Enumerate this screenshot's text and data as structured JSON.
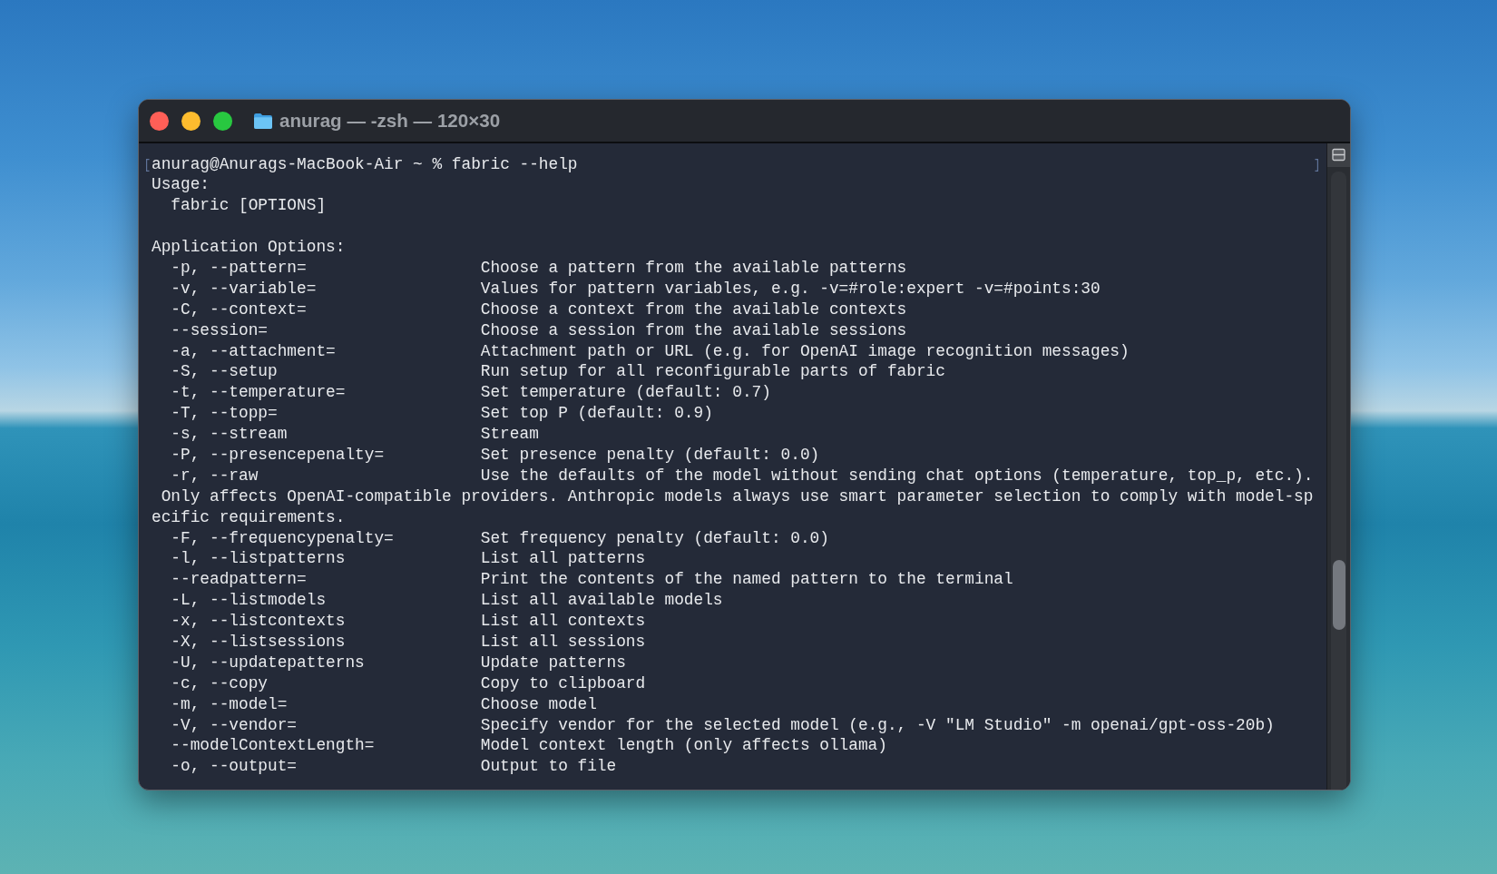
{
  "window": {
    "title": "anurag — -zsh — 120×30",
    "controls": [
      {
        "color": "#ff5f57"
      },
      {
        "color": "#febc2e"
      },
      {
        "color": "#28c840"
      }
    ]
  },
  "terminal": {
    "prompt": {
      "text": "anurag@Anurags-MacBook-Air ~ % fabric --help",
      "marked": true
    },
    "lines": [
      {
        "kind": "plain",
        "text": "Usage:"
      },
      {
        "kind": "indented",
        "text": "fabric [OPTIONS]"
      },
      {
        "kind": "blank"
      },
      {
        "kind": "plain",
        "text": "Application Options:"
      },
      {
        "kind": "option",
        "flag": "-p, --pattern=",
        "description": "Choose a pattern from the available patterns"
      },
      {
        "kind": "option",
        "flag": "-v, --variable=",
        "description": "Values for pattern variables, e.g. -v=#role:expert -v=#points:30"
      },
      {
        "kind": "option",
        "flag": "-C, --context=",
        "description": "Choose a context from the available contexts"
      },
      {
        "kind": "option",
        "flag": "--session=",
        "description": "Choose a session from the available sessions"
      },
      {
        "kind": "option",
        "flag": "-a, --attachment=",
        "description": "Attachment path or URL (e.g. for OpenAI image recognition messages)"
      },
      {
        "kind": "option",
        "flag": "-S, --setup",
        "description": "Run setup for all reconfigurable parts of fabric"
      },
      {
        "kind": "option",
        "flag": "-t, --temperature=",
        "description": "Set temperature (default: 0.7)"
      },
      {
        "kind": "option",
        "flag": "-T, --topp=",
        "description": "Set top P (default: 0.9)"
      },
      {
        "kind": "option",
        "flag": "-s, --stream",
        "description": "Stream"
      },
      {
        "kind": "option",
        "flag": "-P, --presencepenalty=",
        "description": "Set presence penalty (default: 0.0)"
      },
      {
        "kind": "option",
        "flag": "-r, --raw",
        "description": "Use the defaults of the model without sending chat options (temperature, top_p, etc.)."
      },
      {
        "kind": "wrapped",
        "text": "Only affects OpenAI-compatible providers. Anthropic models always use smart parameter selection to comply with model-sp"
      },
      {
        "kind": "plain",
        "text": "ecific requirements."
      },
      {
        "kind": "option",
        "flag": "-F, --frequencypenalty=",
        "description": "Set frequency penalty (default: 0.0)"
      },
      {
        "kind": "option",
        "flag": "-l, --listpatterns",
        "description": "List all patterns"
      },
      {
        "kind": "option",
        "flag": "--readpattern=",
        "description": "Print the contents of the named pattern to the terminal"
      },
      {
        "kind": "option",
        "flag": "-L, --listmodels",
        "description": "List all available models"
      },
      {
        "kind": "option",
        "flag": "-x, --listcontexts",
        "description": "List all contexts"
      },
      {
        "kind": "option",
        "flag": "-X, --listsessions",
        "description": "List all sessions"
      },
      {
        "kind": "option",
        "flag": "-U, --updatepatterns",
        "description": "Update patterns"
      },
      {
        "kind": "option",
        "flag": "-c, --copy",
        "description": "Copy to clipboard"
      },
      {
        "kind": "option",
        "flag": "-m, --model=",
        "description": "Choose model"
      },
      {
        "kind": "option",
        "flag": "-V, --vendor=",
        "description": "Specify vendor for the selected model (e.g., -V \"LM Studio\" -m openai/gpt-oss-20b)"
      },
      {
        "kind": "option",
        "flag": "--modelContextLength=",
        "description": "Model context length (only affects ollama)"
      },
      {
        "kind": "option",
        "flag": "-o, --output=",
        "description": "Output to file"
      }
    ]
  }
}
